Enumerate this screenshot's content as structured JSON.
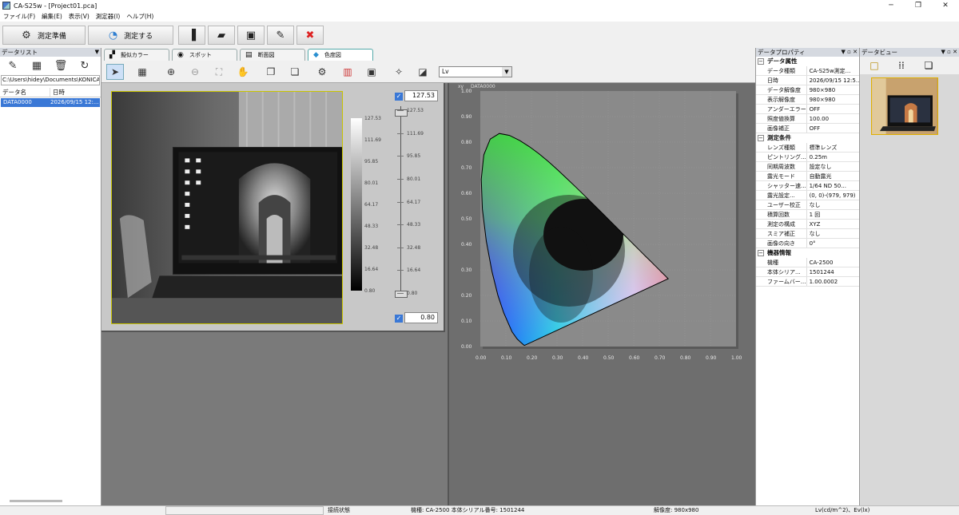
{
  "window": {
    "title": "CA-S25w - [Project01.pca]",
    "controls": [
      "─",
      "❐",
      "✕"
    ]
  },
  "menu": [
    "ファイル(F)",
    "編集(E)",
    "表示(V)",
    "測定器(I)",
    "ヘルプ(H)"
  ],
  "toolbar": {
    "prepare_label": "測定準備",
    "measure_label": "測定する"
  },
  "data_list": {
    "title": "データリスト",
    "path": "C:\\Users\\hidey\\Documents\\KONICA",
    "columns": [
      "データ名",
      "日時"
    ],
    "rows": [
      {
        "name": "DATA0000",
        "date": "2026/09/15 12:..."
      }
    ]
  },
  "tabs": [
    {
      "label": "擬似カラー",
      "icon": "palette-icon"
    },
    {
      "label": "スポット",
      "icon": "target-icon"
    },
    {
      "label": "断面図",
      "icon": "chart-icon"
    },
    {
      "label": "色度図",
      "icon": "tag-icon"
    }
  ],
  "view": {
    "display_select": "Lv"
  },
  "image": {
    "colorbar_labels": [
      "127.53",
      "111.69",
      "95.85",
      "80.01",
      "64.17",
      "48.33",
      "32.48",
      "16.64",
      "0.80"
    ],
    "slider_max": "127.53",
    "slider_min": "0.80"
  },
  "chromaticity": {
    "label_xy": "xy",
    "label_data": "DATA0000",
    "y_ticks": [
      "1.00",
      "0.90",
      "0.80",
      "0.70",
      "0.60",
      "0.50",
      "0.40",
      "0.30",
      "0.20",
      "0.10",
      "0.00"
    ],
    "x_ticks": [
      "0.00",
      "0.10",
      "0.20",
      "0.30",
      "0.40",
      "0.50",
      "0.60",
      "0.70",
      "0.80",
      "0.90",
      "1.00"
    ]
  },
  "properties": {
    "title": "データプロパティ",
    "groups": [
      {
        "name": "データ属性",
        "rows": [
          [
            "データ種類",
            "CA-S25w測定..."
          ],
          [
            "日時",
            "2026/09/15 12:5..."
          ],
          [
            "データ解像度",
            "980×980"
          ],
          [
            "表示解像度",
            "980×980"
          ],
          [
            "アンダーエラー",
            "OFF"
          ],
          [
            "照度値換算",
            "100.00"
          ],
          [
            "画像補正",
            "OFF"
          ]
        ]
      },
      {
        "name": "測定条件",
        "rows": [
          [
            "レンズ種類",
            "標準レンズ"
          ],
          [
            "ピントリング...",
            "0.25m"
          ],
          [
            "同期周波数",
            "設定なし"
          ],
          [
            "露光モード",
            "自動露光"
          ],
          [
            "シャッター速...",
            "1/64 ND 50..."
          ],
          [
            "露光設定...",
            "(0, 0)-(979, 979)"
          ],
          [
            "ユーザー校正",
            "なし"
          ],
          [
            "積算回数",
            "1 回"
          ],
          [
            "測定の構成",
            "XYZ"
          ],
          [
            "スミア補正",
            "なし"
          ],
          [
            "画像の向き",
            "0°"
          ]
        ]
      },
      {
        "name": "機器情報",
        "rows": [
          [
            "機種",
            "CA-2500"
          ],
          [
            "本体シリア...",
            "1501244"
          ],
          [
            "ファームバー...",
            "1.00.0002"
          ]
        ]
      }
    ]
  },
  "data_view": {
    "title": "データビュー"
  },
  "status": {
    "connection": "接続状態",
    "device": "機種: CA-2500 本体シリアル番号: 1501244",
    "resolution": "解像度: 980x980",
    "unit": "Lv(cd/m^2)、Ev(lx)"
  }
}
